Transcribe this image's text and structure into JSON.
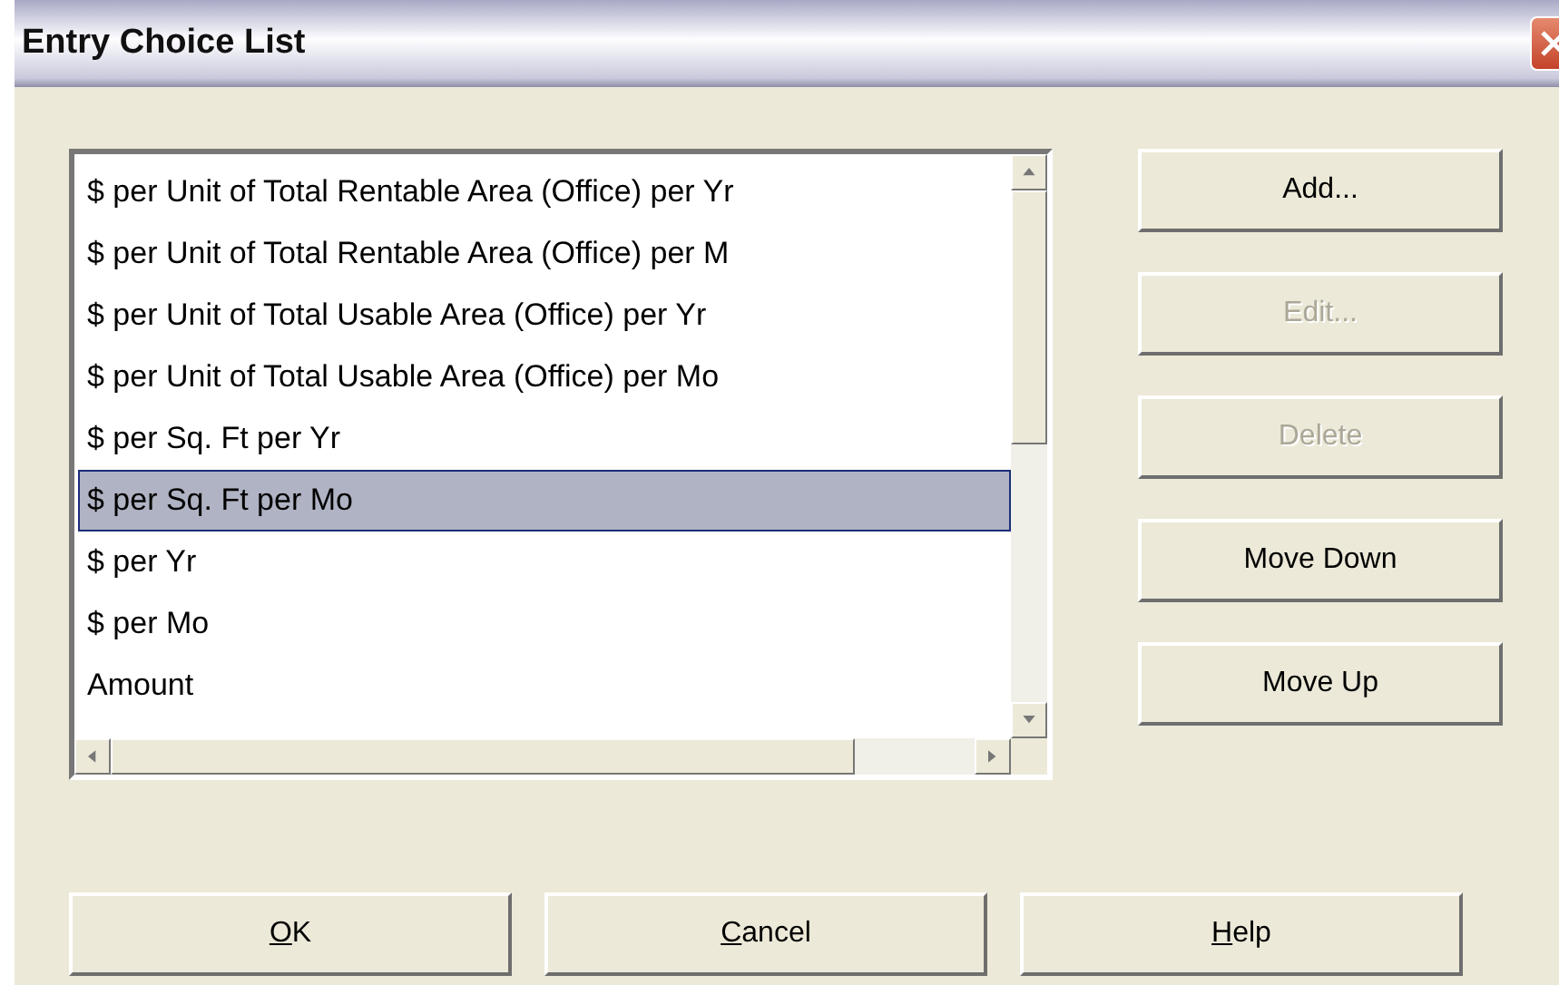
{
  "window": {
    "title": "Entry Choice List"
  },
  "list": {
    "items": [
      {
        "label": "$ per Unit of Total Rentable Area (Office) per Yr",
        "selected": false
      },
      {
        "label": "$ per Unit of Total Rentable Area (Office) per M",
        "selected": false
      },
      {
        "label": "$ per Unit of Total Usable Area (Office) per Yr",
        "selected": false
      },
      {
        "label": "$ per Unit of Total Usable Area (Office) per Mo",
        "selected": false
      },
      {
        "label": "$ per Sq. Ft per Yr",
        "selected": false
      },
      {
        "label": "$ per Sq. Ft per Mo",
        "selected": true
      },
      {
        "label": "$ per Yr",
        "selected": false
      },
      {
        "label": "$ per Mo",
        "selected": false
      },
      {
        "label": "Amount",
        "selected": false
      }
    ]
  },
  "side_buttons": [
    {
      "label": "Add...",
      "disabled": false
    },
    {
      "label": "Edit...",
      "disabled": true
    },
    {
      "label": "Delete",
      "disabled": true
    },
    {
      "label": "Move Down",
      "disabled": false
    },
    {
      "label": "Move Up",
      "disabled": false
    }
  ],
  "bottom_buttons": [
    {
      "label": "OK",
      "underline_first": true
    },
    {
      "label": "Cancel",
      "underline_first": true
    },
    {
      "label": "Help",
      "underline_first": true
    }
  ]
}
